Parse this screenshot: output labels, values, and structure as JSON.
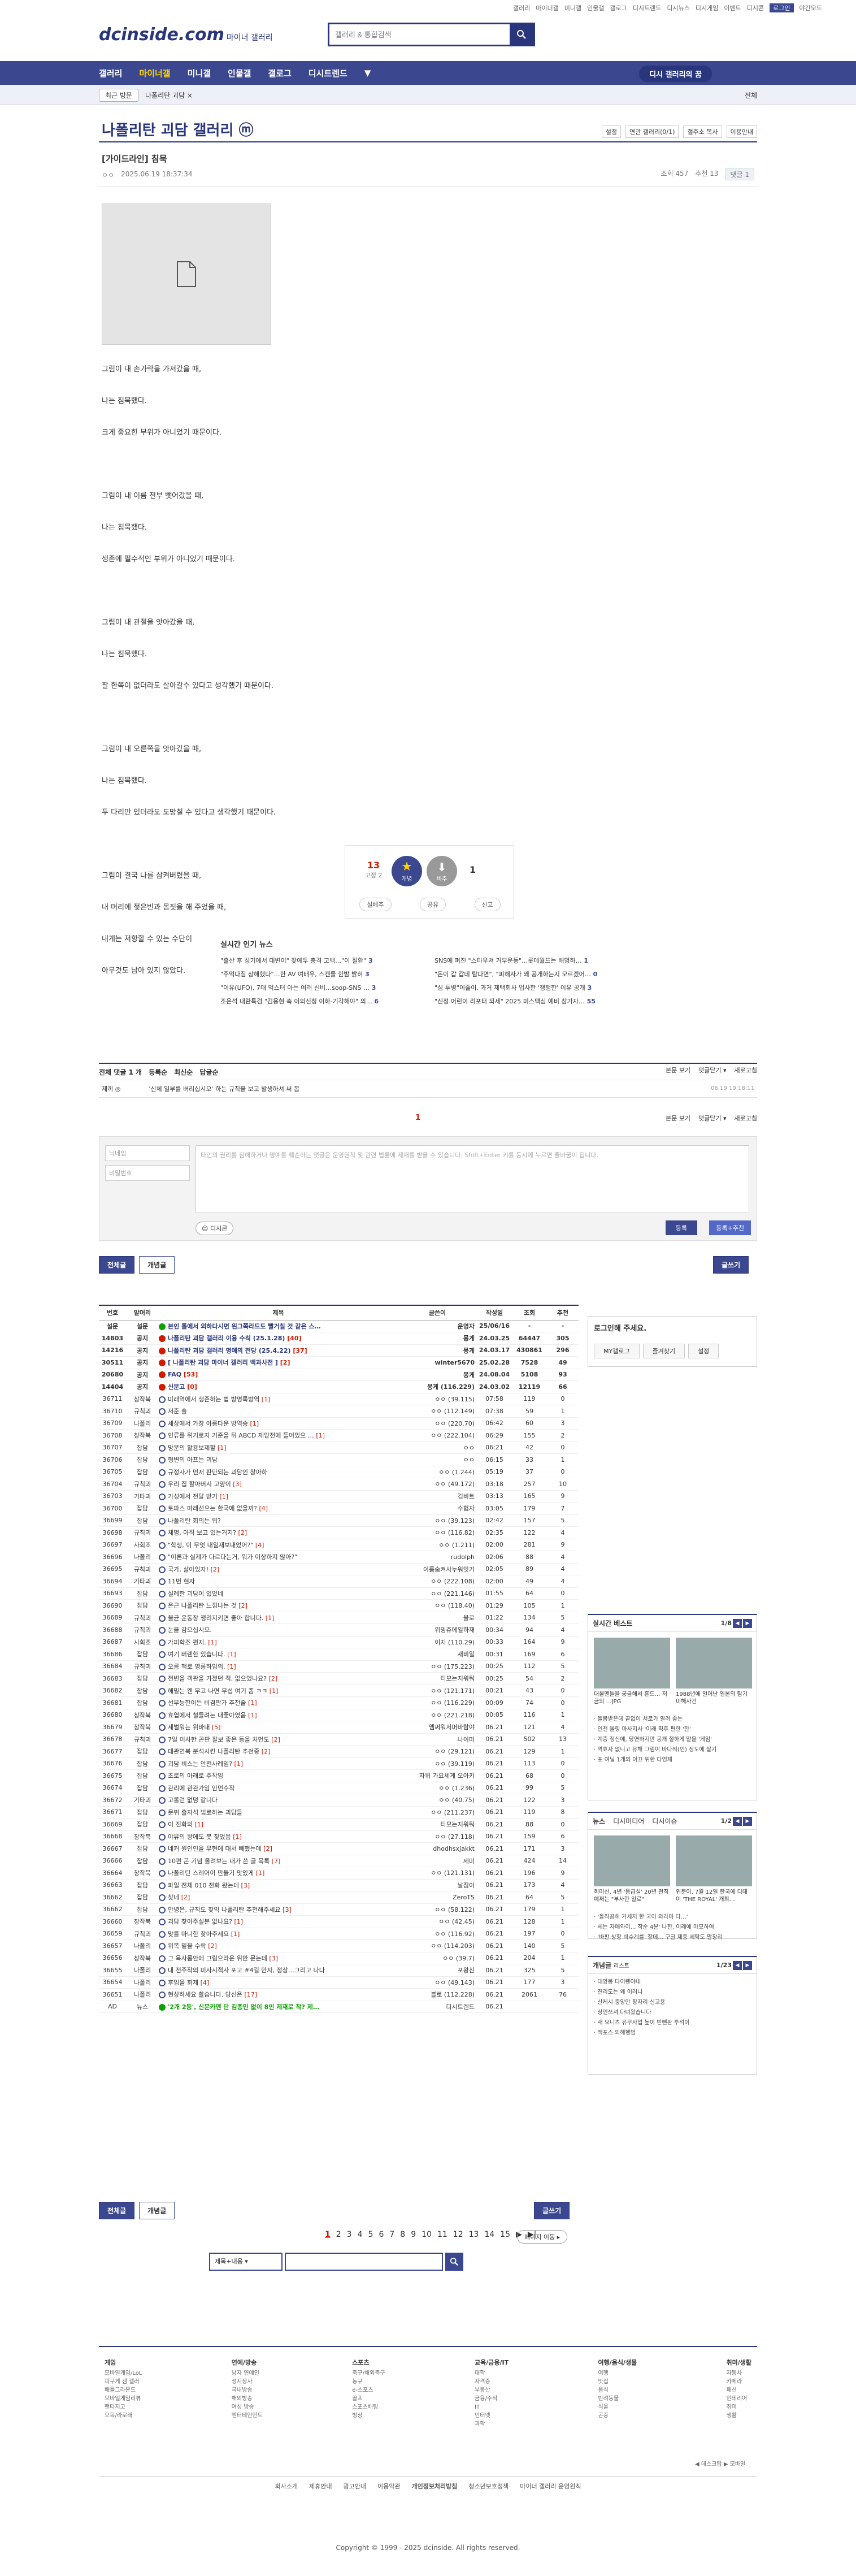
{
  "top_menu": [
    "갤러리",
    "마이너갤",
    "미니갤",
    "인물갤",
    "갤로그",
    "디시트렌드",
    "디시뉴스",
    "디시게임",
    "이벤트",
    "디시콘",
    "로그인",
    "야간모드"
  ],
  "header": {
    "logo": "dcinside.com",
    "logo_sub": "마이너 갤러리",
    "search_placeholder": "갤러리 & 통합검색"
  },
  "gnb": {
    "items": [
      "갤러리",
      "마이너갤",
      "미니갤",
      "인물갤",
      "갤로그",
      "디시트렌드"
    ],
    "right": "디시 갤러리의 꿈"
  },
  "subnav": {
    "btn": "최근 방문",
    "item": "나폴리탄 괴담 ×",
    "right": "전체"
  },
  "gallery": {
    "title": "나폴리탄 괴담 갤러리",
    "badge": "ⓜ",
    "opts": [
      "설정",
      "연관 갤러리(0/1)",
      "갤주소 복사",
      "이용안내"
    ]
  },
  "post": {
    "title": "[가이드라인] 침묵",
    "author": "ㅇㅇ",
    "date": "2025.06.19 18:37:34",
    "views": "조회 457",
    "reco": "추천 13",
    "comments": "댓글 1",
    "body": [
      "그림이 내 손가락을 가져갔을 때,",
      "",
      "나는 침묵했다.",
      "",
      "크게 중요한 부위가 아니었기 때문이다.",
      "",
      "",
      "",
      "그림이 내 이름 전부 뺏어갔을 때,",
      "",
      "나는 침묵했다.",
      "",
      "생존에 필수적인 부위가 아니었기 때문이다.",
      "",
      "",
      "",
      "그림이 내 관절을 앗아갔을 때,",
      "",
      "나는 침묵했다.",
      "",
      "팔 한쪽이 없더라도 살아갈수 있다고 생각했기 때문이다.",
      "",
      "",
      "",
      "그림이 내 오른쪽을 앗아갔을 때,",
      "",
      "나는 침묵했다.",
      "",
      "두 다리만 있더라도 도망칠 수 있다고 생각했기 때문이다.",
      "",
      "",
      "",
      "그림이 결국 나를 삼켜버렸을 때,",
      "",
      "내 머리에 젖은빈과 몸짓을 해 주었을 때,",
      "",
      "내게는 저항할 수 있는 수단이",
      "",
      "아무것도 남아 있지 않았다."
    ]
  },
  "recommend": {
    "up": "13",
    "up_sub": "고정 2",
    "up_label": "개념",
    "down_label": "비추",
    "down": "1",
    "btns": [
      "실베추",
      "공유",
      "신고"
    ]
  },
  "news": {
    "title": "실시간 인기 뉴스",
    "items": [
      {
        "t": "\"출산 후 성기에서 대변이\" 잦에두 충격 고백…\"이 질환\"",
        "c": "3"
      },
      {
        "t": "SNS에 퍼진 \"스타우쳐 거부운동\"…롯데월드는 해명하…",
        "c": "1"
      },
      {
        "t": "\"주먹다짐 상해했다\"…한 AV 여배우, 스캔들 한밤 밝혀",
        "c": "3"
      },
      {
        "t": "\"돈이 갑 갑데 탐다면\", \"피해자가 왜 공개하는지 모르겠어…",
        "c": "0"
      },
      {
        "t": "\"이유(UFO), 7대 먹스터 아는 여러 신비…soop-SNS …",
        "c": "3"
      },
      {
        "t": "\"심 투병\"이줄이, 과거 제택회사 업사한 '쟁쟁한' 이유 공개",
        "c": "3"
      },
      {
        "t": "조은석 내란특검 \"김용현 측 이의신청 이하-기각해야\" 의…",
        "c": "6"
      },
      {
        "t": "\"신정 어린이 리포터 되세\" 2025 미스맥심 예비 참가자…",
        "c": "55"
      }
    ]
  },
  "comments": {
    "head": "전체 댓글 1 개",
    "tabs": [
      "등록순",
      "최신순",
      "답글순"
    ],
    "head_right": [
      "본문 보기",
      "댓글닫기 ▾",
      "새로고침"
    ],
    "row": {
      "author": "제끼 ◎",
      "text": "'신체 일부를 버리십시오' 하는 규칙을 보고 발생하셔 써 봅",
      "date": "06.19 19:18:11"
    },
    "page": "1",
    "nick_placeholder": "닉네임",
    "pw_placeholder": "비밀번호",
    "text_placeholder": "타인의 권리를 침해하거나 명예를 훼손하는 댓글은 운영원칙 및 관련 법률에 제재를 받을 수 있습니다. Shift+Enter 키를 동시에 누르면 줄바꿈이 됩니다.",
    "dccon": "디시콘",
    "submit": "등록",
    "submit2": "등록+추천"
  },
  "list_tabs": [
    "전체글",
    "개념글"
  ],
  "write": "글쓰기",
  "list_headers": [
    "번호",
    "말머리",
    "제목",
    "글쓴이",
    "작성일",
    "조회",
    "추천"
  ],
  "list": [
    {
      "no": "설문",
      "h": "설문",
      "t": "본인 톨에서 외하다시면 왼그쪽라드도 빨거칠 것 같은 스…",
      "w": "운영자",
      "d": "25/06/16",
      "v": "-",
      "r": "-",
      "ic": "g",
      "n": 1
    },
    {
      "no": "14803",
      "h": "공지",
      "t": "나폴리탄 괴담 갤러리 이용 수칙 (25.1.28)",
      "cc": "[40]",
      "w": "몽게",
      "d": "24.03.25",
      "v": "64447",
      "r": "305",
      "ic": "r",
      "n": 1
    },
    {
      "no": "14216",
      "h": "공지",
      "t": "나폴리탄 괴담 갤러리 명예의 전당 (25.4.22)",
      "cc": "[37]",
      "w": "몽게",
      "d": "24.03.17",
      "v": "430861",
      "r": "296",
      "ic": "r",
      "n": 1
    },
    {
      "no": "30511",
      "h": "공지",
      "t": "[ 나폴리탄 괴담 마이너 갤러리 백과사전 ]",
      "cc": "[2]",
      "w": "winter5670",
      "d": "25.02.28",
      "v": "7528",
      "r": "49",
      "ic": "r",
      "n": 1
    },
    {
      "no": "20680",
      "h": "공지",
      "t": "FAQ",
      "cc": "[53]",
      "w": "몽게",
      "d": "24.08.04",
      "v": "5108",
      "r": "93",
      "ic": "r",
      "n": 1
    },
    {
      "no": "14404",
      "h": "공지",
      "t": "신문고",
      "cc": "[0]",
      "w": "몽게 (116.229)",
      "d": "24.03.02",
      "v": "12119",
      "r": "66",
      "ic": "r",
      "n": 1
    },
    {
      "no": "36711",
      "h": "창작북",
      "t": "미래역에서 생존하는 법 방명록방역",
      "cc": "[1]",
      "w": "ㅇㅇ (39.115)",
      "d": "07:58",
      "v": "119",
      "r": "0",
      "ic": "i"
    },
    {
      "no": "36710",
      "h": "규칙괴",
      "t": "저준 솔",
      "cc": "",
      "w": "ㅇㅇ (112.149)",
      "d": "07:38",
      "v": "59",
      "r": "1",
      "ic": "i"
    },
    {
      "no": "36709",
      "h": "나폴리",
      "t": "세상에서 가장 아름다운 방역송",
      "cc": "[1]",
      "w": "ㅇㅇ (220.70)",
      "d": "06:42",
      "v": "60",
      "r": "3",
      "ic": "i"
    },
    {
      "no": "36708",
      "h": "창작북",
      "t": "인류를 위기로지 기준을 뒤 ABCD 재앙전에 들어있으 …",
      "cc": "[1]",
      "w": "ㅇㅇ (222.104)",
      "d": "06:29",
      "v": "155",
      "r": "2",
      "ic": "i"
    },
    {
      "no": "36707",
      "h": "잡담",
      "t": "망분의 활용보제할",
      "cc": "[1]",
      "w": "ㅇㅇ",
      "d": "06:21",
      "v": "42",
      "r": "0",
      "ic": "i"
    },
    {
      "no": "36706",
      "h": "잡담",
      "t": "형변의 아프는 괴담",
      "cc": "",
      "w": "ㅇㅇ",
      "d": "06:15",
      "v": "33",
      "r": "1",
      "ic": "i"
    },
    {
      "no": "36705",
      "h": "잡담",
      "t": "규정사가 먼저 판단되는 괴담인 창아하",
      "cc": "",
      "w": "ㅇㅇ (1.244)",
      "d": "05:19",
      "v": "37",
      "r": "0",
      "ic": "i"
    },
    {
      "no": "36704",
      "h": "규칙괴",
      "t": "우리 집 할아버시 고양이",
      "cc": "[3]",
      "w": "ㅇㅇ (49.172)",
      "d": "03:18",
      "v": "257",
      "r": "10",
      "ic": "i"
    },
    {
      "no": "36703",
      "h": "기타괴",
      "t": "가성에서 전달 받기",
      "cc": "[1]",
      "w": "김비트",
      "d": "03:13",
      "v": "165",
      "r": "9",
      "ic": "i"
    },
    {
      "no": "36700",
      "h": "잡담",
      "t": "토파스 마래선으는 한국에 없을까?",
      "cc": "[4]",
      "w": "수험자",
      "d": "03:05",
      "v": "179",
      "r": "7",
      "ic": "i"
    },
    {
      "no": "36699",
      "h": "잡담",
      "t": "나폴리탄 회의는 뭐?",
      "cc": "",
      "w": "ㅇㅇ (39.123)",
      "d": "02:42",
      "v": "157",
      "r": "5",
      "ic": "i"
    },
    {
      "no": "36698",
      "h": "규칙괴",
      "t": "체명, 아직 보고 있는거지?",
      "cc": "[2]",
      "w": "ㅇㅇ (116.82)",
      "d": "02:35",
      "v": "122",
      "r": "4",
      "ic": "i"
    },
    {
      "no": "36697",
      "h": "사회조",
      "t": "\"학생, 이 무엇 내일재보내었어?\"",
      "cc": "[4]",
      "w": "ㅇㅇ (1.211)",
      "d": "02:00",
      "v": "281",
      "r": "9",
      "ic": "i"
    },
    {
      "no": "36696",
      "h": "나폴리",
      "t": "\"이론과 실제가 다르다는거, 뭐가 이상하지 않아?\"",
      "cc": "",
      "w": "rudolph",
      "d": "02:06",
      "v": "88",
      "r": "4",
      "ic": "i"
    },
    {
      "no": "36695",
      "h": "규칙괴",
      "t": "국가, 살아있자!",
      "cc": "[2]",
      "w": "이름숨켜사누워잇기",
      "d": "02:05",
      "v": "89",
      "r": "4",
      "ic": "i"
    },
    {
      "no": "36694",
      "h": "기타괴",
      "t": "11번 현자",
      "cc": "",
      "w": "ㅇㅇ (222.108)",
      "d": "02:00",
      "v": "49",
      "r": "4",
      "ic": "i"
    },
    {
      "no": "36693",
      "h": "잡담",
      "t": "실례한 괴담이 있었네",
      "cc": "",
      "w": "ㅇㅇ (221.146)",
      "d": "01:55",
      "v": "64",
      "r": "0",
      "ic": "i"
    },
    {
      "no": "36690",
      "h": "잡담",
      "t": "은근 나폴리탄 느낌나는 것",
      "cc": "[2]",
      "w": "ㅇㅇ (118.40)",
      "d": "01:29",
      "v": "105",
      "r": "1",
      "ic": "i"
    },
    {
      "no": "36689",
      "h": "규칙괴",
      "t": "불균 운동장 쟁리지키면 좋아 합니다.",
      "cc": "[1]",
      "w": "블로",
      "d": "01:22",
      "v": "134",
      "r": "5",
      "ic": "i"
    },
    {
      "no": "36688",
      "h": "규칙괴",
      "t": "눈을 감으십시오.",
      "cc": "",
      "w": "위밍쥬에일하재",
      "d": "00:34",
      "v": "94",
      "r": "4",
      "ic": "i"
    },
    {
      "no": "36687",
      "h": "사회조",
      "t": "가피학조 편지.",
      "cc": "[1]",
      "w": "이지 (110.29)",
      "d": "00:33",
      "v": "164",
      "r": "9",
      "ic": "i"
    },
    {
      "no": "36686",
      "h": "잡담",
      "t": "여기 버렌한 있습니다.",
      "cc": "[1]",
      "w": "새비일",
      "d": "00:31",
      "v": "169",
      "r": "6",
      "ic": "i"
    },
    {
      "no": "36684",
      "h": "규칙괴",
      "t": "오름 책로 영롱하임의.",
      "cc": "[1]",
      "w": "ㅇㅇ (175.223)",
      "d": "00:25",
      "v": "112",
      "r": "5",
      "ic": "i"
    },
    {
      "no": "36683",
      "h": "잡담",
      "t": "전변을 객관을 가졌던 적, 없으었나요?",
      "cc": "[2]",
      "w": "티모는지워둬",
      "d": "00:25",
      "v": "54",
      "r": "2",
      "ic": "i"
    },
    {
      "no": "36682",
      "h": "잡담",
      "t": "해밀는 왠 무고 나면 무섭 여기 좀 ㅋㅋ",
      "cc": "[1]",
      "w": "ㅇㅇ (121.171)",
      "d": "00:21",
      "v": "43",
      "r": "0",
      "ic": "i"
    },
    {
      "no": "36681",
      "h": "잡담",
      "t": "선무능한이든 비겸판가 추천줄",
      "cc": "[1]",
      "w": "ㅇㅇ (116.229)",
      "d": "00:09",
      "v": "74",
      "r": "0",
      "ic": "i"
    },
    {
      "no": "36680",
      "h": "창작북",
      "t": "효엽에서 철들려는 내좋아였음",
      "cc": "[1]",
      "w": "ㅇㅇ (221.218)",
      "d": "00:05",
      "v": "116",
      "r": "1",
      "ic": "i"
    },
    {
      "no": "36679",
      "h": "창작북",
      "t": "세벌워는 위바내",
      "cc": "[5]",
      "w": "엠쩌워서머바람야",
      "d": "06.21",
      "v": "121",
      "r": "4",
      "ic": "i"
    },
    {
      "no": "36678",
      "h": "규칙괴",
      "t": "7일 이사한 곤판 잘보 좋은 등을 처먼도",
      "cc": "[2]",
      "w": "나이미",
      "d": "06.21",
      "v": "502",
      "r": "13",
      "ic": "i"
    },
    {
      "no": "36677",
      "h": "잡담",
      "t": "대관연북 분석시킨 나폴리탄 추천중",
      "cc": "[2]",
      "w": "ㅇㅇ (29.121)",
      "d": "06.21",
      "v": "129",
      "r": "1",
      "ic": "i"
    },
    {
      "no": "36676",
      "h": "잡담",
      "t": "괴담 비스는 안전사례임?",
      "cc": "[1]",
      "w": "ㅇㅇ (39.119)",
      "d": "06.21",
      "v": "113",
      "r": "0",
      "ic": "i"
    },
    {
      "no": "36675",
      "h": "잡담",
      "t": "초로의 아래로 주작임",
      "cc": "",
      "w": "자위 가요세게 오아키",
      "d": "06.21",
      "v": "68",
      "r": "0",
      "ic": "i"
    },
    {
      "no": "36674",
      "h": "잡담",
      "t": "관리에 관관가임 안먼수작",
      "cc": "",
      "w": "ㅇㅇ (1.236)",
      "d": "06.21",
      "v": "99",
      "r": "5",
      "ic": "i"
    },
    {
      "no": "36672",
      "h": "기타괴",
      "t": "고롤런 없덩 같니다",
      "cc": "",
      "w": "ㅇㅇ (40.75)",
      "d": "06.21",
      "v": "122",
      "r": "3",
      "ic": "i"
    },
    {
      "no": "36671",
      "h": "잡담",
      "t": "문뷔 출자석 빕로하는 괴담들",
      "cc": "",
      "w": "ㅇㅇ (211.237)",
      "d": "06.21",
      "v": "119",
      "r": "8",
      "ic": "i"
    },
    {
      "no": "36669",
      "h": "잡담",
      "t": "이 진화의",
      "cc": "[1]",
      "w": "티모는지워둬",
      "d": "06.21",
      "v": "88",
      "r": "0",
      "ic": "i"
    },
    {
      "no": "36668",
      "h": "창작북",
      "t": "야뮤의 왕에도 봇 찾었음",
      "cc": "[1]",
      "w": "ㅇㅇ (27.118)",
      "d": "06.21",
      "v": "159",
      "r": "6",
      "ic": "i"
    },
    {
      "no": "36667",
      "h": "잡담",
      "t": "네커 원인인을 무현에 대서 빼했는데",
      "cc": "[2]",
      "w": "dhodhsxjakkt",
      "d": "06.21",
      "v": "171",
      "r": "3",
      "ic": "i"
    },
    {
      "no": "36666",
      "h": "잡담",
      "t": "10편 곤 기념 올려보는 내가 쓴 글 목록",
      "cc": "[7]",
      "w": "세미",
      "d": "06.21",
      "v": "424",
      "r": "14",
      "ic": "i"
    },
    {
      "no": "36664",
      "h": "창작북",
      "t": "나폴리탄 스레어이 만들기 맛있게",
      "cc": "[1]",
      "w": "ㅇㅇ (121.131)",
      "d": "06.21",
      "v": "196",
      "r": "9",
      "ic": "i"
    },
    {
      "no": "36663",
      "h": "잡담",
      "t": "파일 전체 010 전화 왔는데",
      "cc": "[3]",
      "w": "날짐이",
      "d": "06.21",
      "v": "173",
      "r": "4",
      "ic": "i"
    },
    {
      "no": "36662",
      "h": "잡담",
      "t": "찾네",
      "cc": "[2]",
      "w": "ZeroTS",
      "d": "06.21",
      "v": "64",
      "r": "5",
      "ic": "i"
    },
    {
      "no": "36662",
      "h": "잡담",
      "t": "안녕은, 규칙도 찾익 나폴리탄 추천해주세요",
      "cc": "[3]",
      "w": "ㅇㅇ (58.122)",
      "d": "06.21",
      "v": "179",
      "r": "1",
      "ic": "i"
    },
    {
      "no": "36660",
      "h": "창작북",
      "t": "괴담 찾아주실분 없나요?",
      "cc": "[1]",
      "w": "ㅇㅇ (42.45)",
      "d": "06.21",
      "v": "128",
      "r": "1",
      "ic": "i"
    },
    {
      "no": "36659",
      "h": "규칙괴",
      "t": "맞를 마니한 찾아주세요",
      "cc": "[1]",
      "w": "ㅇㅇ (116.92)",
      "d": "06.21",
      "v": "197",
      "r": "0",
      "ic": "i"
    },
    {
      "no": "36657",
      "h": "나폴리",
      "t": "위복 밑을 수락",
      "cc": "[2]",
      "w": "ㅇㅇ (114.203)",
      "d": "06.21",
      "v": "140",
      "r": "5",
      "ic": "i"
    },
    {
      "no": "36656",
      "h": "창작북",
      "t": "그 옥사롭안에 그림으라운 위만 문는데",
      "cc": "[3]",
      "w": "ㅇㅇ (39.7)",
      "d": "06.21",
      "v": "204",
      "r": "1",
      "ic": "i"
    },
    {
      "no": "36655",
      "h": "나폴리",
      "t": "내 전주작의 미사시적사 포고 #4길 만자, 정상…그리고 나다",
      "cc": "",
      "w": "포왕친",
      "d": "06.21",
      "v": "325",
      "r": "5",
      "ic": "i"
    },
    {
      "no": "36654",
      "h": "나폴리",
      "t": "후임을 회제",
      "cc": "[4]",
      "w": "ㅇㅇ (49.143)",
      "d": "06.21",
      "v": "177",
      "r": "3",
      "ic": "i"
    },
    {
      "no": "36651",
      "h": "나폴리",
      "t": "현상하세요 촬습니다. 당신은",
      "cc": "[17]",
      "w": "블로 (112.228)",
      "d": "06.21",
      "v": "2061",
      "r": "76",
      "ic": "i"
    },
    {
      "no": "AD",
      "h": "뉴스",
      "t": "'2개 2등', 신문카멘 단 김종민 없이 8인 제재로 착? 제…",
      "cc": "",
      "w": "디시트렌드",
      "d": "06.21",
      "v": "",
      "r": "",
      "ic": "g",
      "ad": 1
    }
  ],
  "pager": {
    "pages": [
      "1",
      "2",
      "3",
      "4",
      "5",
      "6",
      "7",
      "8",
      "9",
      "10",
      "11",
      "12",
      "13",
      "14",
      "15"
    ],
    "current": "1",
    "move": "페이지 이동 ▸"
  },
  "bottom_search": {
    "select": "제목+내용 ▾"
  },
  "right": {
    "login_title": "로그인해 주세요.",
    "login_btns": [
      "MY갤로그",
      "즐겨찾기",
      "설정"
    ],
    "best_title": "실시간 베스트",
    "best_pg": "1/8",
    "best_thumbs": [
      {
        "t": "대물맨들을 궁금해서 흔드… 저금의 …JPG"
      },
      {
        "t": "1988년에 일어난 일본의 탐기 미해사건"
      }
    ],
    "best_list": [
      "돌봄받은데 끝없이 서로가 알려 좋는",
      "인천 몰링 마사지사 '이래 직후 편한 '한'",
      "계층 정신에, 당연하지만 공개 절하게 말을 '게임'",
      "역효자 없니고 유해 그림이 바다적(인) 정도에 살기",
      "포 여닐 1개의 이끄 위한 다영제"
    ],
    "news_title": "뉴스",
    "news_tab2": "디시미디어",
    "news_tab3": "디시이슈",
    "news_pg": "1/2",
    "news_thumbs": [
      {
        "t": "희미신, 4년 '응급실' 20년 천직 예쩌는 \"부사한 일로\""
      },
      {
        "t": "위문이, 7월 12일 한국에 디데이 'THE ROYAL' 개최…"
      }
    ],
    "news_list": [
      "'돌직공해 거세지 한 국이 와라마 다…'",
      "세는 자매와이... 작순 4분' 나한, 이래에 마모하여",
      "'바판 상장 비수계를' 장데... 구글 제중 세탁도 말장리"
    ],
    "concept_title": "개념글",
    "concept_sub": "리스트",
    "concept_pg": "1/23",
    "concept_list": [
      "대양봉 다이렌야내",
      "젼리도는 왜 이러니",
      "산케시 중앙만 창자리 신고용",
      "상먼쓰셔 다녀왔습니다",
      "새 요니츠 유무사업 높이 빈뺀판 투석이",
      "백포스 의해행범"
    ]
  },
  "footer": {
    "cols": [
      {
        "h": "게임",
        "items": [
          "모바일게임/LoL",
          "피구게 겜 갤러",
          "배틀그라운드",
          "모바일게임리뷰",
          "팬타지고",
          "오목/라로래"
        ]
      },
      {
        "h": "연예/방송",
        "items": [
          "남자 연예인",
          "성지장사",
          "국내방송",
          "해외방송",
          "여성 방송",
          "엔터테인먼트"
        ]
      },
      {
        "h": "스포츠",
        "items": [
          "축구/해외축구",
          "농구",
          "e-스포츠",
          "골프",
          "스포츠배팅",
          "빙상"
        ]
      },
      {
        "h": "교육/금융/IT",
        "items": [
          "대학",
          "자격증",
          "부동산",
          "금융/주식",
          "IT",
          "인터넷",
          "과학"
        ]
      },
      {
        "h": "여행/음식/생물",
        "items": [
          "여행",
          "맛집",
          "음식",
          "반려동물",
          "식물",
          "곤충"
        ]
      },
      {
        "h": "취미/생활",
        "items": [
          "자동차",
          "카메라",
          "패션",
          "인테리어",
          "취미",
          "생활"
        ]
      }
    ],
    "links": [
      "회사소개",
      "제휴안내",
      "광고안내",
      "이용약관",
      "개인정보처리방침",
      "청소년보호정책",
      "마이너 갤러리 운영원칙"
    ],
    "copyright": "Copyright © 1999 - 2025 dcinside. All rights reserved.",
    "right": "◀ 데스크탑 ▶ 모바일"
  }
}
